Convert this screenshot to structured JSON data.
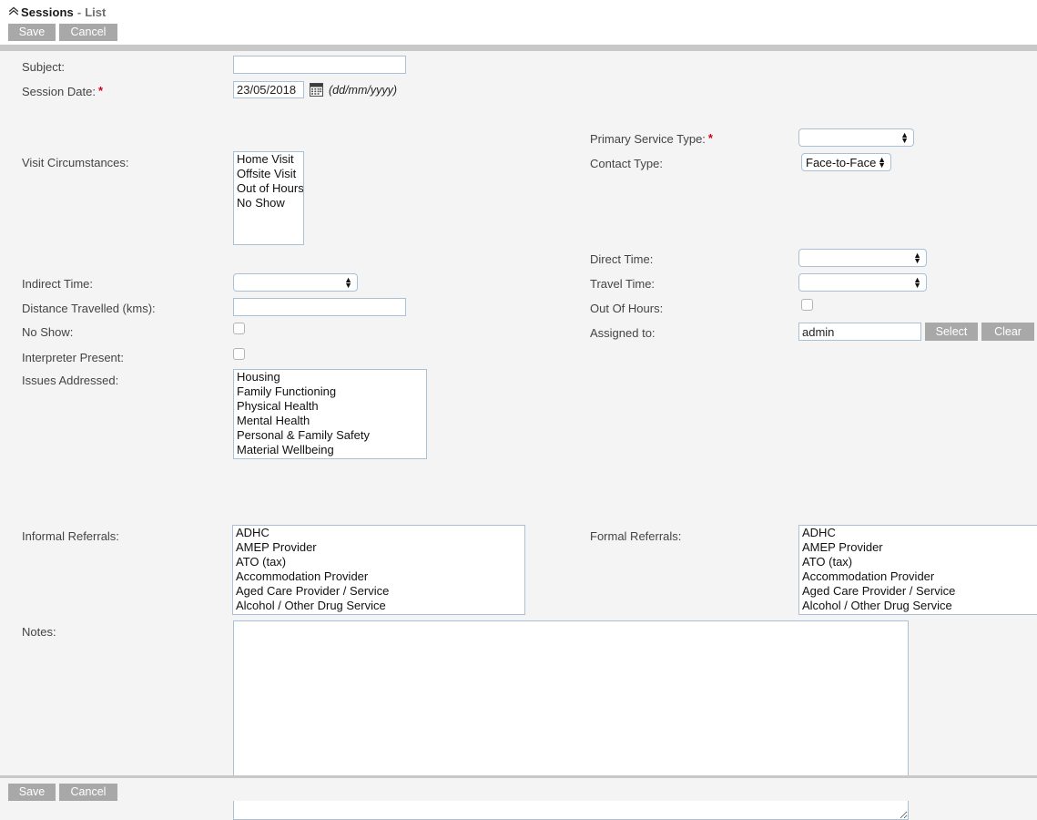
{
  "header": {
    "breadcrumb": {
      "collapse_icon": "chevron-double-up-icon",
      "title": "Sessions",
      "separator": "-",
      "link": "List"
    },
    "save_label": "Save",
    "cancel_label": "Cancel"
  },
  "form": {
    "subject": {
      "label": "Subject:",
      "value": "",
      "placeholder": ""
    },
    "session_date": {
      "label": "Session Date:",
      "required": true,
      "value": "23/05/2018",
      "format_hint": "(dd/mm/yyyy)",
      "calendar_icon": "calendar-icon"
    },
    "visit_circumstances": {
      "label": "Visit Circumstances:",
      "options": [
        "Home Visit",
        "Offsite Visit",
        "Out of Hours",
        "No Show"
      ]
    },
    "primary_service_type": {
      "label": "Primary Service Type:",
      "required": true,
      "value": "",
      "options": [
        ""
      ]
    },
    "contact_type": {
      "label": "Contact Type:",
      "value": "Face-to-Face",
      "options": [
        "Face-to-Face"
      ]
    },
    "direct_time": {
      "label": "Direct Time:",
      "value": "",
      "options": [
        ""
      ]
    },
    "indirect_time": {
      "label": "Indirect Time:",
      "value": "",
      "options": [
        ""
      ]
    },
    "travel_time": {
      "label": "Travel Time:",
      "value": "",
      "options": [
        ""
      ]
    },
    "distance_travelled": {
      "label": "Distance Travelled (kms):",
      "value": ""
    },
    "out_of_hours": {
      "label": "Out Of Hours:",
      "checked": false
    },
    "no_show": {
      "label": "No Show:",
      "checked": false
    },
    "interpreter_present": {
      "label": "Interpreter Present:",
      "checked": false
    },
    "assigned_to": {
      "label": "Assigned to:",
      "value": "admin",
      "select_label": "Select",
      "clear_label": "Clear"
    },
    "issues_addressed": {
      "label": "Issues Addressed:",
      "options": [
        "Housing",
        "Family Functioning",
        "Physical Health",
        "Mental Health",
        "Personal & Family Safety",
        "Material Wellbeing"
      ]
    },
    "informal_referrals": {
      "label": "Informal Referrals:",
      "options": [
        "ADHC",
        "AMEP Provider",
        "ATO (tax)",
        "Accommodation Provider",
        "Aged Care Provider / Service",
        "Alcohol / Other Drug Service"
      ]
    },
    "formal_referrals": {
      "label": "Formal Referrals:",
      "options": [
        "ADHC",
        "AMEP Provider",
        "ATO (tax)",
        "Accommodation Provider",
        "Aged Care Provider / Service",
        "Alcohol / Other Drug Service"
      ]
    },
    "notes": {
      "label": "Notes:",
      "value": "",
      "placeholder": ""
    }
  },
  "footer": {
    "save_label": "Save",
    "cancel_label": "Cancel"
  },
  "colors": {
    "page_background": "#f4f4f4",
    "header_background": "#ffffff",
    "button_gray": "#a8a8a8",
    "divider_gray": "#c8c8c8",
    "input_border": "#a9c0d6",
    "required_red": "#d0021b"
  }
}
